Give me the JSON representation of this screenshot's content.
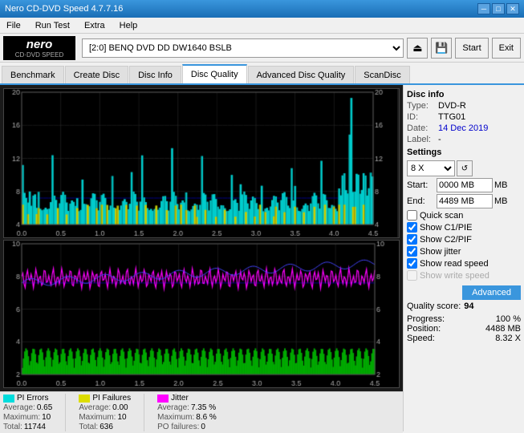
{
  "titleBar": {
    "title": "Nero CD-DVD Speed 4.7.7.16",
    "minimize": "─",
    "maximize": "□",
    "close": "✕"
  },
  "menu": {
    "items": [
      "File",
      "Run Test",
      "Extra",
      "Help"
    ]
  },
  "toolbar": {
    "driveLabel": "[2:0]  BENQ DVD DD DW1640 BSLB",
    "startBtn": "Start",
    "exitBtn": "Exit"
  },
  "tabs": [
    {
      "label": "Benchmark",
      "active": false
    },
    {
      "label": "Create Disc",
      "active": false
    },
    {
      "label": "Disc Info",
      "active": false
    },
    {
      "label": "Disc Quality",
      "active": true
    },
    {
      "label": "Advanced Disc Quality",
      "active": false
    },
    {
      "label": "ScanDisc",
      "active": false
    }
  ],
  "discInfo": {
    "sectionTitle": "Disc info",
    "typeLabel": "Type:",
    "typeValue": "DVD-R",
    "idLabel": "ID:",
    "idValue": "TTG01",
    "dateLabel": "Date:",
    "dateValue": "14 Dec 2019",
    "labelLabel": "Label:",
    "labelValue": "-"
  },
  "settings": {
    "sectionTitle": "Settings",
    "speedValue": "8 X",
    "startLabel": "Start:",
    "startValue": "0000 MB",
    "endLabel": "End:",
    "endValue": "4489 MB",
    "quickScan": "Quick scan",
    "showC1PIE": "Show C1/PIE",
    "showC2PIF": "Show C2/PIF",
    "showJitter": "Show jitter",
    "showReadSpeed": "Show read speed",
    "showWriteSpeed": "Show write speed",
    "advancedBtn": "Advanced"
  },
  "qualityScore": {
    "label": "Quality score:",
    "value": "94"
  },
  "progress": {
    "progressLabel": "Progress:",
    "progressValue": "100 %",
    "positionLabel": "Position:",
    "positionValue": "4488 MB",
    "speedLabel": "Speed:",
    "speedValue": "8.32 X"
  },
  "legend": {
    "piErrors": {
      "label": "PI Errors",
      "color": "#00dddd",
      "averageLabel": "Average:",
      "averageValue": "0.65",
      "maximumLabel": "Maximum:",
      "maximumValue": "10",
      "totalLabel": "Total:",
      "totalValue": "11744"
    },
    "piFailures": {
      "label": "PI Failures",
      "color": "#dddd00",
      "averageLabel": "Average:",
      "averageValue": "0.00",
      "maximumLabel": "Maximum:",
      "maximumValue": "10",
      "totalLabel": "Total:",
      "totalValue": "636"
    },
    "jitter": {
      "label": "Jitter",
      "color": "#ff00ff",
      "averageLabel": "Average:",
      "averageValue": "7.35 %",
      "maximumLabel": "Maximum:",
      "maximumValue": "8.6 %",
      "poLabel": "PO failures:",
      "poValue": "0"
    }
  },
  "chart1": {
    "yMax": 20,
    "yLabels": [
      20,
      16,
      12,
      8,
      4
    ],
    "xLabels": [
      "0.0",
      "0.5",
      "1.0",
      "1.5",
      "2.0",
      "2.5",
      "3.0",
      "3.5",
      "4.0",
      "4.5"
    ]
  },
  "chart2": {
    "yMax": 10,
    "yLabels": [
      10,
      8,
      6,
      4,
      2
    ],
    "xLabels": [
      "0.0",
      "0.5",
      "1.0",
      "1.5",
      "2.0",
      "2.5",
      "3.0",
      "3.5",
      "4.0",
      "4.5"
    ]
  }
}
